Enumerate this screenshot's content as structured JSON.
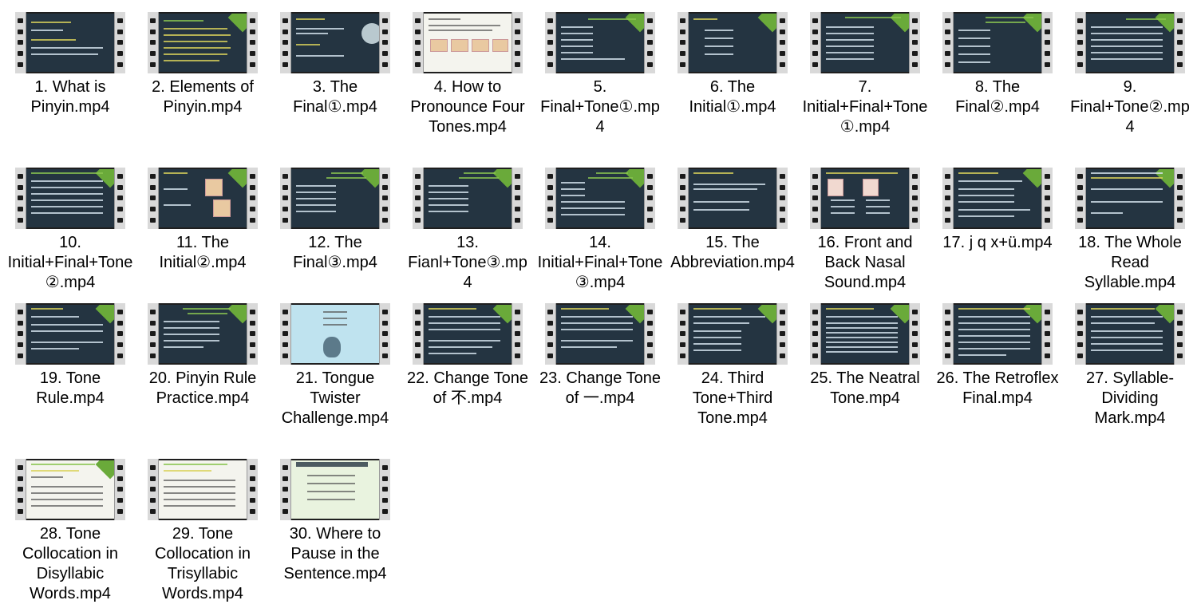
{
  "files": [
    {
      "name": "1. What is Pinyin.mp4"
    },
    {
      "name": "2. Elements of Pinyin.mp4"
    },
    {
      "name": "3. The Final①.mp4"
    },
    {
      "name": "4. How to Pronounce Four Tones.mp4"
    },
    {
      "name": "5. Final+Tone①.mp4"
    },
    {
      "name": "6. The Initial①.mp4"
    },
    {
      "name": "7. Initial+Final+Tone①.mp4"
    },
    {
      "name": "8. The Final②.mp4"
    },
    {
      "name": "9. Final+Tone②.mp4"
    },
    {
      "name": "10. Initial+Final+Tone②.mp4"
    },
    {
      "name": "11. The Initial②.mp4"
    },
    {
      "name": "12. The Final③.mp4"
    },
    {
      "name": "13. Fianl+Tone③.mp4"
    },
    {
      "name": "14. Initial+Final+Tone③.mp4"
    },
    {
      "name": "15. The Abbreviation.mp4"
    },
    {
      "name": "16. Front and Back Nasal Sound.mp4"
    },
    {
      "name": "17. j q x+ü.mp4"
    },
    {
      "name": "18. The Whole Read Syllable.mp4"
    },
    {
      "name": "19. Tone Rule.mp4"
    },
    {
      "name": "20. Pinyin Rule Practice.mp4"
    },
    {
      "name": "21. Tongue Twister Challenge.mp4"
    },
    {
      "name": "22. Change Tone of 不.mp4"
    },
    {
      "name": "23. Change Tone of 一.mp4"
    },
    {
      "name": "24. Third Tone+Third Tone.mp4"
    },
    {
      "name": "25. The Neatral Tone.mp4"
    },
    {
      "name": "26. The Retroflex Final.mp4"
    },
    {
      "name": "27. Syllable-Dividing Mark.mp4"
    },
    {
      "name": "28. Tone Collocation in Disyllabic Words.mp4"
    },
    {
      "name": "29. Tone Collocation in Trisyllabic Words.mp4"
    },
    {
      "name": "30. Where to Pause in the Sentence.mp4"
    }
  ]
}
